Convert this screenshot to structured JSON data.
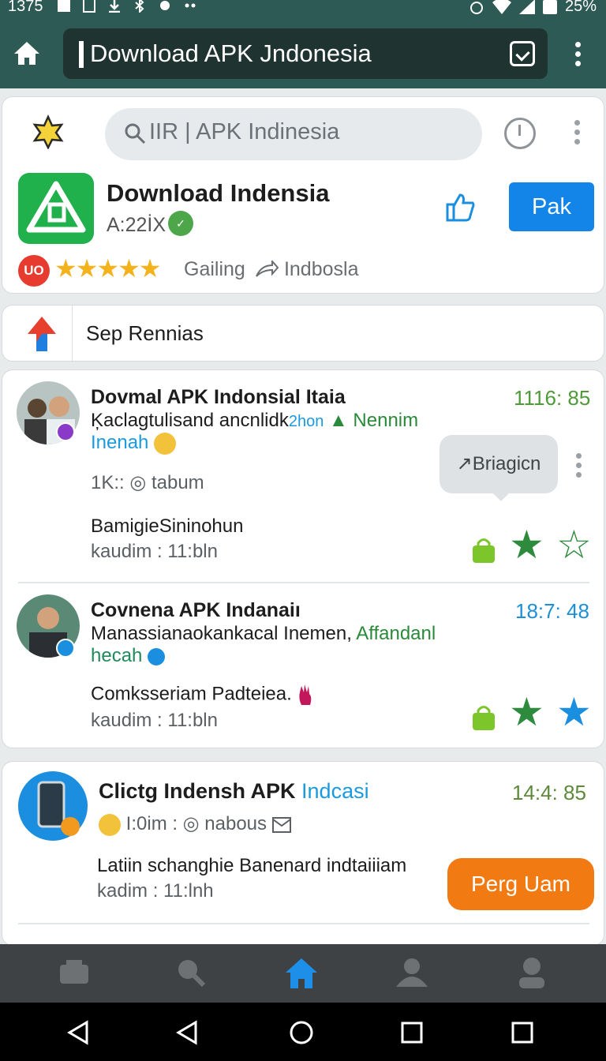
{
  "status_bar": {
    "time": "1375",
    "battery": "25%"
  },
  "browser": {
    "url": "Download APK Jndonesia"
  },
  "app_header": {
    "search_text": "IIR | APK Indinesia",
    "app_title": "Download Indensia",
    "app_sub": "A:22İX",
    "primary_button": "Pak",
    "rating_badge": "UO",
    "rating_label_1": "Gailing",
    "rating_label_2": "Indbosla"
  },
  "section": {
    "label": "Sep Rennias"
  },
  "items": [
    {
      "title": "Dovmal APK Indonsial Itaia",
      "line1": "Ķaclagtulisand ancnlidk",
      "line1_small": "2hon",
      "line1_extra": "▲ Nennim",
      "line2": "Inenah",
      "meta": "1K:: ◎ tabum",
      "desc": "BamigieSininohun",
      "sub": "kaudim : 11:bln",
      "time": "1116: 85",
      "tooltip": "↗Briagicn"
    },
    {
      "title": "Covnena APK Indanaiı",
      "line1": "Manassianaokankacal Inemen,",
      "line1_extra": "Affandanl",
      "line2": "hecah",
      "desc": "Comksseriam Padteiea.",
      "sub": "kaudim : 11:bln",
      "time": "18:7: 48"
    },
    {
      "title": "Clictg Indensh APK",
      "title_blue": "Indcasi",
      "meta": "I:0im : ◎ nabous",
      "desc": "Latiin schanghie Banenard indtaiiiam",
      "sub": "kadim : 11:lnh",
      "time": "14:4: 85",
      "button": "Perg Uam"
    }
  ],
  "colors": {
    "accent": "#1485e8",
    "topbar": "#2e5a55",
    "orange": "#f27a13",
    "green": "#20b14c"
  }
}
